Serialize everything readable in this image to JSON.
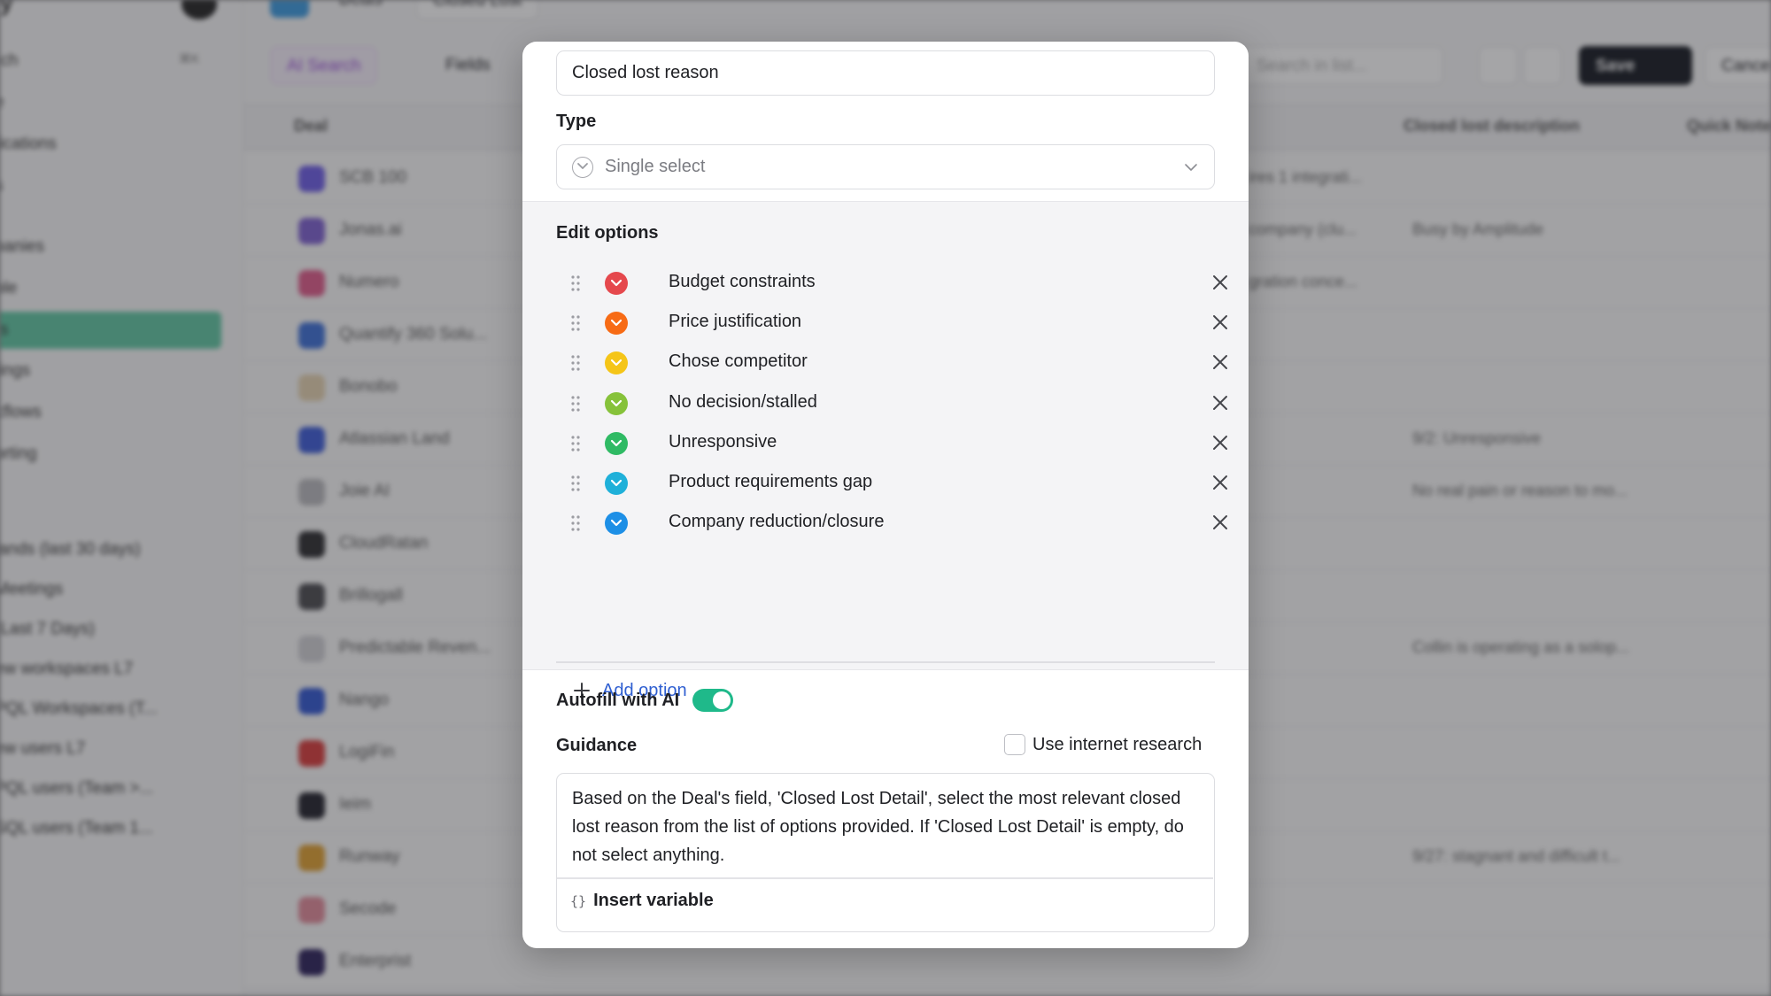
{
  "background": {
    "sidebar": {
      "title": "ry",
      "items": [
        "rch",
        "e",
        "fications",
        "s",
        "panies",
        "ple",
        "s",
        "tings",
        "kflows",
        "orting",
        "lands (last 30 days)",
        "Meetings",
        "(Last 7 Days)",
        "ew workspaces L7",
        "PQL Workspaces (T...",
        "ew users L7",
        "PQL users (Team >...",
        "SQL users (Team 1..."
      ],
      "shortcut": "⌘K"
    },
    "toolbar": {
      "tab_deals": "Deals",
      "tab_closed_lost": "Closed Lost",
      "ai_search": "AI Search",
      "fields": "Fields",
      "search_placeholder": "Search in list...",
      "save": "Save",
      "cancel": "Cancel"
    },
    "columns": [
      "Deal",
      "Closed lost description",
      "Quick Notes"
    ],
    "rows": [
      {
        "name": "SCB 100",
        "c1": "ires 1 integrati...",
        "c2": ""
      },
      {
        "name": "Jonas.ai",
        "c1": "company (clu...",
        "c2": "Busy by Amplitude"
      },
      {
        "name": "Numero",
        "c1": "gration conce...",
        "c2": ""
      },
      {
        "name": "Quantify 360 Solu...",
        "c1": "",
        "c2": ""
      },
      {
        "name": "Bonobo",
        "c1": "",
        "c2": ""
      },
      {
        "name": "Atlassian Land",
        "c1": "",
        "c2": "9/2: Unresponsive"
      },
      {
        "name": "Joie AI",
        "c1": "",
        "c2": "No real pain or reason to mo..."
      },
      {
        "name": "CloudRatan",
        "c1": "",
        "c2": ""
      },
      {
        "name": "Brillogall",
        "c1": "",
        "c2": ""
      },
      {
        "name": "Predictable Reven...",
        "c1": "",
        "c2": "Collin is operating as a solop..."
      },
      {
        "name": "Nango",
        "c1": "",
        "c2": ""
      },
      {
        "name": "LogiFin",
        "c1": "",
        "c2": ""
      },
      {
        "name": "Ieim",
        "c1": "",
        "c2": ""
      },
      {
        "name": "Runway",
        "c1": "",
        "c2": "9/27: stagnant and difficult t..."
      },
      {
        "name": "Secode",
        "c1": "",
        "c2": ""
      },
      {
        "name": "Enterprist",
        "c1": "",
        "c2": ""
      }
    ]
  },
  "modal": {
    "field_name_value": "Closed lost reason",
    "type_label": "Type",
    "type_value": "Single select",
    "edit_options_label": "Edit options",
    "options": [
      {
        "label": "Budget constraints",
        "color": "#e5484d"
      },
      {
        "label": "Price justification",
        "color": "#f76b15"
      },
      {
        "label": "Chose competitor",
        "color": "#f5c518"
      },
      {
        "label": "No decision/stalled",
        "color": "#86c23a"
      },
      {
        "label": "Unresponsive",
        "color": "#2fba64"
      },
      {
        "label": "Product requirements gap",
        "color": "#1fb0d9"
      },
      {
        "label": "Company reduction/closure",
        "color": "#1d8fe6"
      }
    ],
    "add_option_label": "Add option",
    "autofill_label": "Autofill with AI",
    "autofill_enabled": true,
    "guidance_label": "Guidance",
    "internet_research_label": "Use internet research",
    "internet_research_checked": false,
    "guidance_text": "Based on the Deal's field, 'Closed Lost Detail', select the most relevant closed lost reason from the list of options provided. If 'Closed Lost Detail' is empty, do not select anything.",
    "insert_variable_label": "Insert variable",
    "accent_color": "#1fb98a",
    "link_color": "#2f5fd1"
  }
}
